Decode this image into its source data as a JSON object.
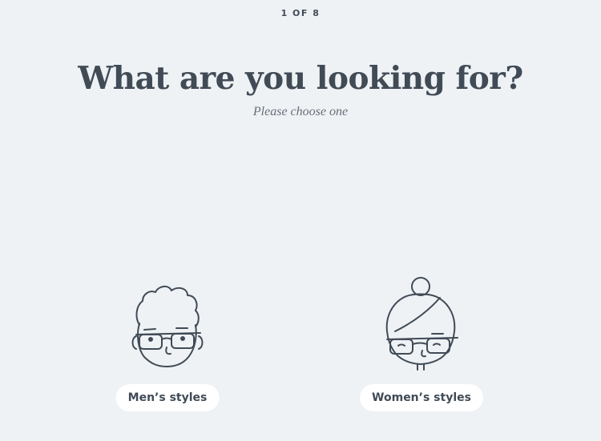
{
  "header": {
    "step_indicator": "1 OF 8",
    "title": "What are you looking for?",
    "subtitle": "Please choose one"
  },
  "choices": [
    {
      "label": "Men’s styles",
      "illustration": "man-face-with-glasses-illustration"
    },
    {
      "label": "Women’s styles",
      "illustration": "woman-face-with-glasses-illustration"
    }
  ],
  "colors": {
    "background": "#eef2f5",
    "text": "#414b56",
    "subtitle": "#676f78",
    "button": "#ffffff"
  }
}
